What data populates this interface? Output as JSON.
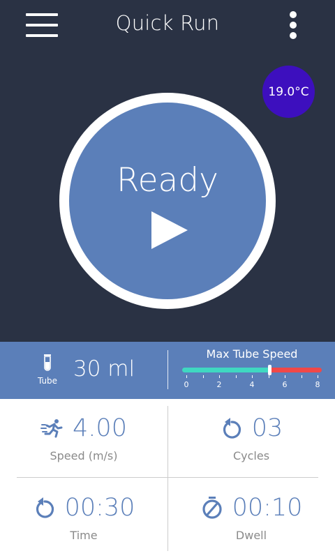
{
  "header": {
    "title": "Quick Run",
    "menu_icon": "hamburger-menu-icon",
    "more_icon": "more-vertical-icon"
  },
  "temperature": "19.0°C",
  "run": {
    "status": "Ready",
    "play_icon": "play-icon"
  },
  "tube": {
    "icon": "test-tube-icon",
    "label": "Tube",
    "volume": "30 ml"
  },
  "max_speed": {
    "title": "Max Tube Speed",
    "min": 0,
    "max": 8,
    "value": 5.0,
    "tick_labels": [
      "0",
      "2",
      "4",
      "6",
      "8"
    ]
  },
  "settings": {
    "speed": {
      "value": "4.00",
      "label": "Speed (m/s)",
      "icon": "running-person-icon"
    },
    "cycles": {
      "value": "03",
      "label": "Cycles",
      "icon": "repeat-arrow-icon"
    },
    "time": {
      "value": "00:30",
      "label": "Time",
      "icon": "repeat-arrow-icon"
    },
    "dwell": {
      "value": "00:10",
      "label": "Dwell",
      "icon": "stopwatch-icon"
    }
  },
  "colors": {
    "background_dark": "#2a3244",
    "accent_blue": "#5b7fb9",
    "temperature_badge": "#3d0fbe",
    "speed_safe": "#3fd8c1",
    "speed_danger": "#f04848"
  }
}
